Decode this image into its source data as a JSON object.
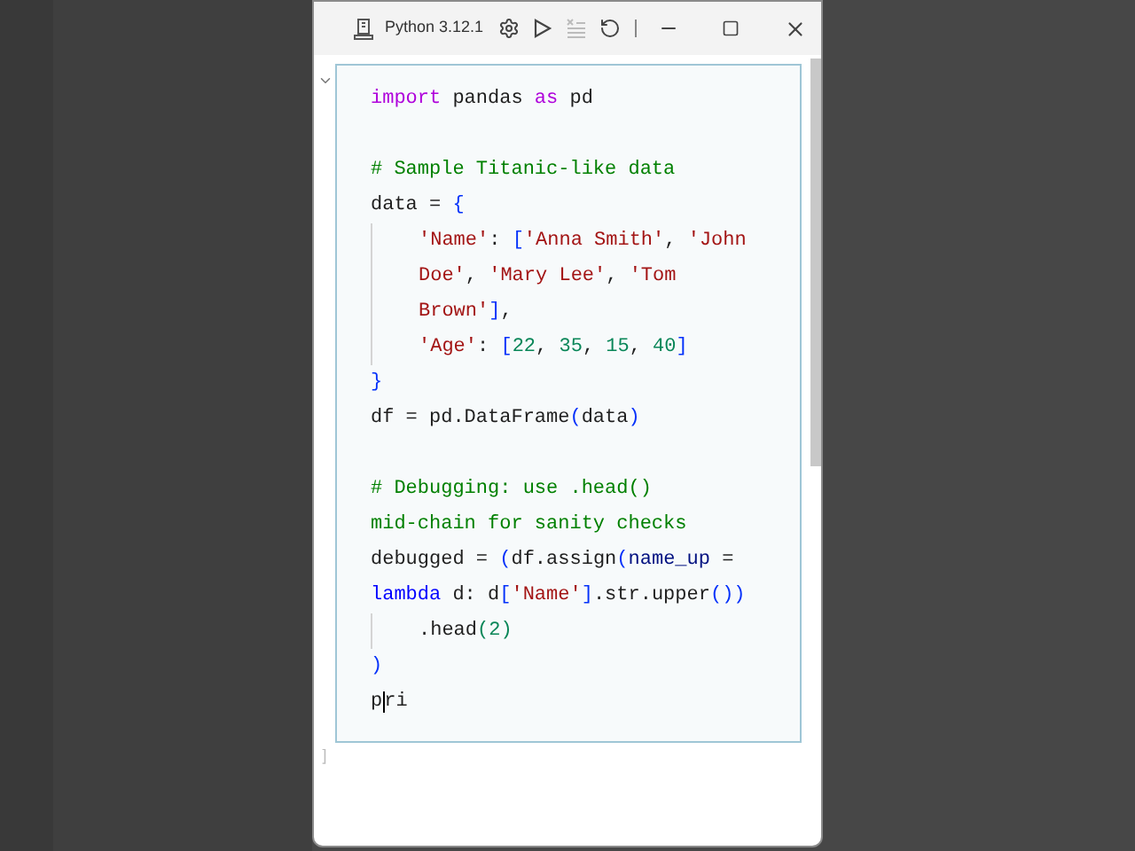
{
  "window": {
    "title": "Python 3.12.1"
  },
  "cell": {
    "expanded": true,
    "exec_marker": "]",
    "lines": [
      {
        "indent": false,
        "tokens": [
          {
            "kind": "keyword",
            "text": "import"
          },
          {
            "kind": "plain",
            "text": " pandas "
          },
          {
            "kind": "keyword",
            "text": "as"
          },
          {
            "kind": "plain",
            "text": " pd"
          }
        ]
      },
      {
        "indent": false
      },
      {
        "indent": false,
        "tokens": [
          {
            "kind": "comment",
            "text": "# Sample Titanic-like data"
          }
        ]
      },
      {
        "indent": false,
        "tokens": [
          {
            "kind": "plain",
            "text": "data = "
          },
          {
            "kind": "bracket",
            "text": "{"
          }
        ]
      },
      {
        "indent": true,
        "tokens": [
          {
            "kind": "string",
            "text": "'Name'"
          },
          {
            "kind": "plain",
            "text": ": "
          },
          {
            "kind": "bracket",
            "text": "["
          },
          {
            "kind": "string",
            "text": "'Anna Smith'"
          },
          {
            "kind": "plain",
            "text": ", "
          },
          {
            "kind": "string",
            "text": "'John"
          }
        ]
      },
      {
        "indent": true,
        "tokens": [
          {
            "kind": "string",
            "text": "Doe'"
          },
          {
            "kind": "plain",
            "text": ", "
          },
          {
            "kind": "string",
            "text": "'Mary Lee'"
          },
          {
            "kind": "plain",
            "text": ", "
          },
          {
            "kind": "string",
            "text": "'Tom"
          }
        ]
      },
      {
        "indent": true,
        "tokens": [
          {
            "kind": "string",
            "text": "Brown'"
          },
          {
            "kind": "bracket",
            "text": "]"
          },
          {
            "kind": "plain",
            "text": ","
          }
        ]
      },
      {
        "indent": true,
        "tokens": [
          {
            "kind": "string",
            "text": "'Age'"
          },
          {
            "kind": "plain",
            "text": ": "
          },
          {
            "kind": "bracket",
            "text": "["
          },
          {
            "kind": "number",
            "text": "22"
          },
          {
            "kind": "plain",
            "text": ", "
          },
          {
            "kind": "number",
            "text": "35"
          },
          {
            "kind": "plain",
            "text": ", "
          },
          {
            "kind": "number",
            "text": "15"
          },
          {
            "kind": "plain",
            "text": ", "
          },
          {
            "kind": "number",
            "text": "40"
          },
          {
            "kind": "bracket",
            "text": "]"
          }
        ]
      },
      {
        "indent": false,
        "tokens": [
          {
            "kind": "bracket",
            "text": "}"
          }
        ]
      },
      {
        "indent": false,
        "tokens": [
          {
            "kind": "plain",
            "text": "df = pd.DataFrame"
          },
          {
            "kind": "bracket",
            "text": "("
          },
          {
            "kind": "plain",
            "text": "data"
          },
          {
            "kind": "bracket",
            "text": ")"
          }
        ]
      },
      {
        "indent": false
      },
      {
        "indent": false,
        "tokens": [
          {
            "kind": "comment",
            "text": "# Debugging: use .head()"
          }
        ]
      },
      {
        "indent": false,
        "tokens": [
          {
            "kind": "comment",
            "text": "mid-chain for sanity checks"
          }
        ]
      },
      {
        "indent": false,
        "tokens": [
          {
            "kind": "plain",
            "text": "debugged = "
          },
          {
            "kind": "bracket",
            "text": "("
          },
          {
            "kind": "plain",
            "text": "df.assign"
          },
          {
            "kind": "bracket",
            "text": "("
          },
          {
            "kind": "param",
            "text": "name_up"
          },
          {
            "kind": "plain",
            "text": " ="
          }
        ]
      },
      {
        "indent": false,
        "tokens": [
          {
            "kind": "storage",
            "text": "lambda"
          },
          {
            "kind": "plain",
            "text": " d: d"
          },
          {
            "kind": "bracket",
            "text": "["
          },
          {
            "kind": "string",
            "text": "'Name'"
          },
          {
            "kind": "bracket",
            "text": "]"
          },
          {
            "kind": "plain",
            "text": ".str.upper"
          },
          {
            "kind": "bracket",
            "text": "())"
          }
        ]
      },
      {
        "indent": true,
        "tokens": [
          {
            "kind": "plain",
            "text": ".head"
          },
          {
            "kind": "number",
            "text": "(2)"
          }
        ]
      },
      {
        "indent": false,
        "tokens": [
          {
            "kind": "bracket",
            "text": ")"
          }
        ]
      },
      {
        "indent": false,
        "tokens": [
          {
            "kind": "plain",
            "text": "p"
          },
          {
            "kind": "plain",
            "text": "ri",
            "caret": true
          }
        ]
      }
    ]
  }
}
